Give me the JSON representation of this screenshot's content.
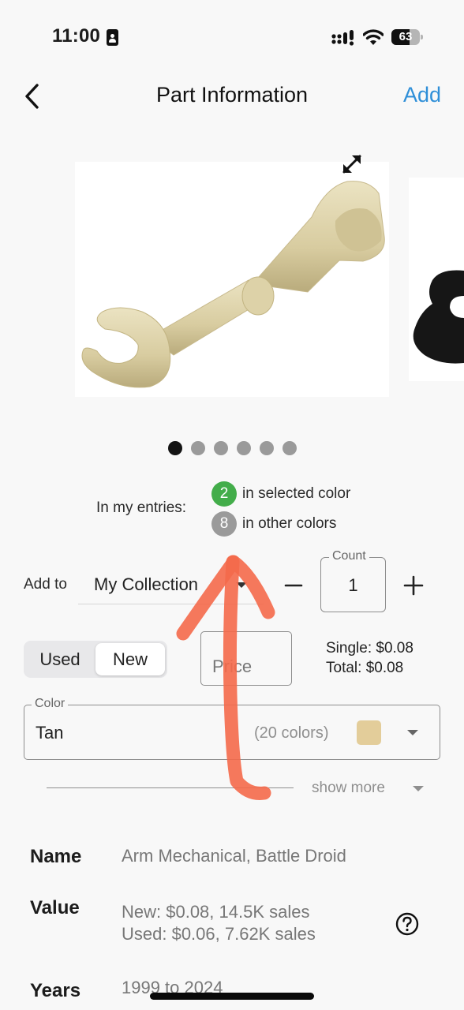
{
  "status_bar": {
    "time": "11:00",
    "battery_percent": 63,
    "battery_label": "63"
  },
  "nav": {
    "back_icon": "chevron-left-icon",
    "title": "Part Information",
    "add_label": "Add"
  },
  "carousel": {
    "page_count": 6,
    "active_index": 0,
    "expand_icon": "expand-arrows-icon",
    "images": [
      "tan battle droid mechanical arm",
      "black part (partially visible)"
    ]
  },
  "entries": {
    "label": "In my entries:",
    "selected_color": {
      "count": "2",
      "text": "in selected color",
      "color": "#43ad4a"
    },
    "other_colors": {
      "count": "8",
      "text": "in other colors",
      "color": "#9a9a9a"
    }
  },
  "add_to": {
    "label": "Add to",
    "collection": "My Collection",
    "count_label": "Count",
    "count_value": "1",
    "decrement_icon": "minus-icon",
    "increment_icon": "plus-icon"
  },
  "condition": {
    "options": [
      "Used",
      "New"
    ],
    "selected": "New"
  },
  "price": {
    "placeholder": "Price",
    "single": "Single: $0.08",
    "total": "Total: $0.08"
  },
  "color": {
    "label": "Color",
    "value": "Tan",
    "count_text": "(20 colors)",
    "swatch": "#e3cd9a"
  },
  "show_more": "show more",
  "details": {
    "name_label": "Name",
    "name_value": "Arm Mechanical, Battle Droid",
    "value_label": "Value",
    "value_new": "New: $0.08, 14.5K sales",
    "value_used": "Used: $0.06, 7.62K sales",
    "years_label": "Years",
    "years_value": "1999 to 2024",
    "help_icon": "question-circle-icon"
  },
  "annotation": {
    "type": "hand-drawn arrow",
    "color": "#f4694a"
  }
}
